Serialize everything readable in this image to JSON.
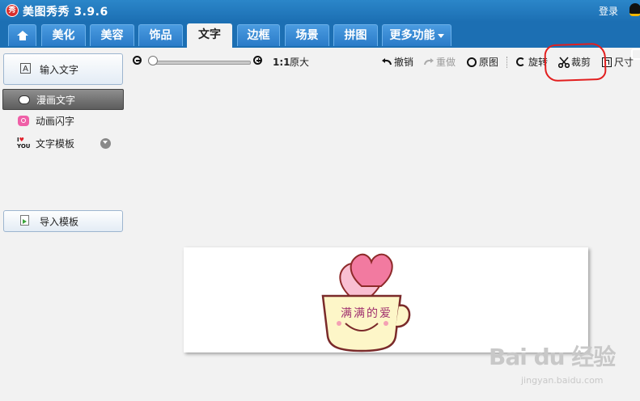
{
  "app": {
    "title": "美图秀秀 3.9.6",
    "logo_char": "秀",
    "login_label": "登录"
  },
  "tabs": [
    {
      "label": "",
      "icon": "home-icon"
    },
    {
      "label": "美化"
    },
    {
      "label": "美容"
    },
    {
      "label": "饰品"
    },
    {
      "label": "文字",
      "active": true
    },
    {
      "label": "边框"
    },
    {
      "label": "场景"
    },
    {
      "label": "拼图"
    },
    {
      "label": "更多功能"
    }
  ],
  "sidebar": {
    "input_text_button": "输入文字",
    "items": [
      {
        "label": "漫画文字",
        "icon": "speech-bubble-icon",
        "selected": true
      },
      {
        "label": "动画闪字",
        "icon": "flash-text-icon"
      },
      {
        "label": "文字模板",
        "icon": "i-love-you-icon",
        "expandable": true
      }
    ],
    "import_template_button": "导入模板",
    "template_icon_text": "I♥YOU"
  },
  "toolbar": {
    "ratio_label": "1:1",
    "original_size_label": "原大",
    "undo_label": "撤销",
    "redo_label": "重做",
    "original_image_label": "原图",
    "rotate_label": "旋转",
    "crop_label": "裁剪",
    "size_label": "尺寸",
    "zoom_level": 0
  },
  "canvas": {
    "image_text": "满满的爱",
    "image_description_icon": "cup-with-hearts-icon"
  },
  "annotation": {
    "highlight_target": "crop-button",
    "color": "#e21f1f"
  },
  "watermark": {
    "logo": "Bai du 经验",
    "url": "jingyan.baidu.com"
  },
  "colors": {
    "titlebar": "#1c6fb3",
    "tab": "#2a7bc8",
    "selected_item": "#6e6e6e",
    "heart_pink": "#f27aa0",
    "cup": "#fdf6c8"
  }
}
